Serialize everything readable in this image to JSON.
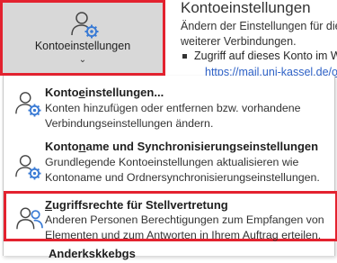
{
  "ribbon": {
    "button_label": "Kontoeinstellungen",
    "chevron": "⌄",
    "icon": "person-gear-icon"
  },
  "info_panel": {
    "title": "Kontoeinstellungen",
    "line1": "Ändern der Einstellungen für dies",
    "line2": "weiterer Verbindungen.",
    "bullet": "Zugriff auf dieses Konto im W",
    "link": "https://mail.uni-kassel.de/ow"
  },
  "menu": {
    "items": [
      {
        "title_before": "Konto",
        "title_accel": "e",
        "title_after": "instellungen...",
        "desc1": "Konten hinzufügen oder entfernen bzw. vorhandene",
        "desc2": "Verbindungseinstellungen ändern.",
        "icon": "person-gear-icon"
      },
      {
        "title_before": "Konto",
        "title_accel": "n",
        "title_after": "ame und Synchronisierungseinstellungen",
        "desc1": "Grundlegende Kontoeinstellungen aktualisieren wie",
        "desc2": "Kontoname und Ordnersynchronisierungseinstellungen.",
        "icon": "person-gear-icon"
      },
      {
        "title_before": "",
        "title_accel": "Z",
        "title_after": "ugriffsrechte für Stellvertretung",
        "desc1": "Anderen Personen Berechtigungen zum Empfangen von",
        "desc2": "Elementen und zum Antworten in Ihrem Auftrag erteilen.",
        "icon": "two-people-icon"
      },
      {
        "title": "Anderkskkebgs"
      }
    ]
  }
}
